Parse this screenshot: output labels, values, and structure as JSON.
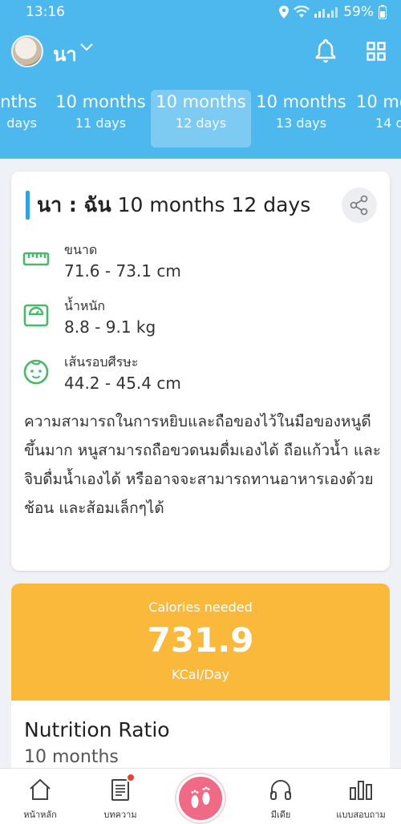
{
  "status": {
    "time": "13:16",
    "battery": "59%"
  },
  "profile": {
    "name": "นา"
  },
  "ages": [
    {
      "months": "onths",
      "days": "days"
    },
    {
      "months": "10 months",
      "days": "11 days"
    },
    {
      "months": "10 months",
      "days": "12 days"
    },
    {
      "months": "10 months",
      "days": "13 days"
    },
    {
      "months": "10 mo",
      "days": "14 d"
    }
  ],
  "card": {
    "title_name": "นา : ฉัน",
    "title_age": " 10 months 12 days",
    "stats": [
      {
        "label": "ขนาด",
        "value": "71.6 - 73.1 cm",
        "icon": "ruler-icon"
      },
      {
        "label": "น้ำหนัก",
        "value": "8.8 - 9.1 kg",
        "icon": "scale-icon"
      },
      {
        "label": "เส้นรอบศีรษะ",
        "value": "44.2 - 45.4 cm",
        "icon": "baby-face-icon"
      }
    ],
    "description": "ความสามารถในการหยิบและถือของไว้ในมือของหนูดีขึ้นมาก หนูสามารถถือขวดนมดื่มเองได้ ถือแก้วน้ำ และจิบดื่มน้ำเองได้ หรืออาจจะสามารถทานอาหารเองด้วยช้อน และส้อมเล็กๆได้"
  },
  "calories": {
    "heading": "Calories needed",
    "value": "731.9",
    "unit": "KCal/Day"
  },
  "nutrition": {
    "title": "Nutrition Ratio",
    "subtitle": "10 months"
  },
  "nav": {
    "home": "หน้าหลัก",
    "articles": "บทความ",
    "media": "มีเดีย",
    "survey": "แบบสอบถาม"
  },
  "colors": {
    "primary": "#4cb8ee",
    "orange": "#fbb93b",
    "pink": "#f06a86",
    "green": "#48b86a"
  }
}
